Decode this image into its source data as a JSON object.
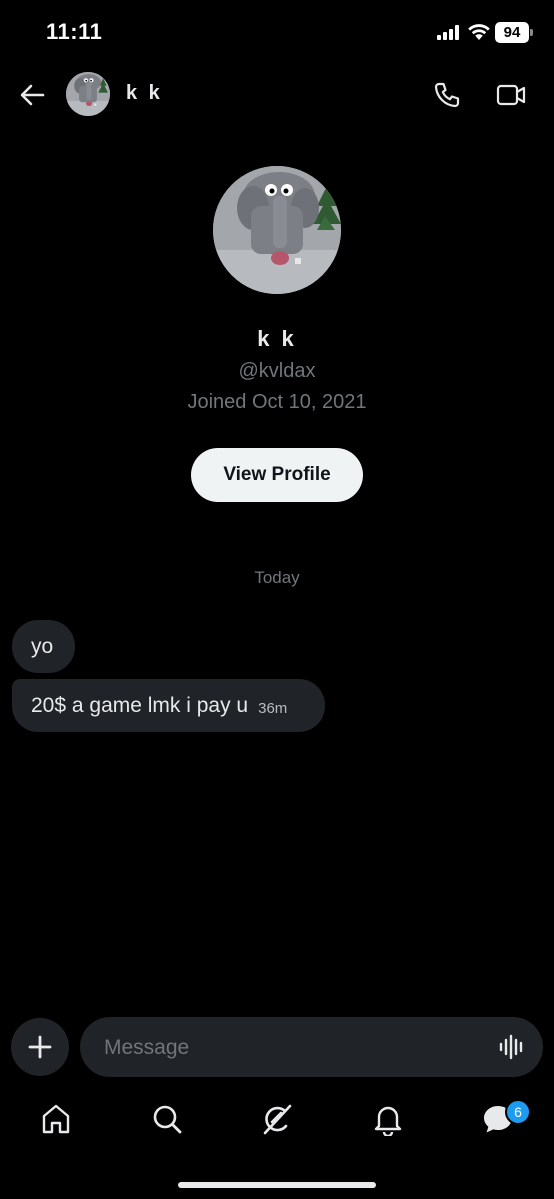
{
  "status_bar": {
    "time": "11:11",
    "battery": "94"
  },
  "header": {
    "name": "k k",
    "avatar_icon": "elephant-avatar"
  },
  "profile": {
    "name": "k k",
    "handle": "@kvldax",
    "joined": "Joined Oct 10, 2021",
    "view_profile_label": "View Profile"
  },
  "chat": {
    "date_separator": "Today",
    "messages": [
      {
        "text": "yo",
        "time": ""
      },
      {
        "text": "20$ a game lmk i pay u",
        "time": "36m"
      }
    ]
  },
  "composer": {
    "placeholder": "Message"
  },
  "nav": {
    "items": [
      "home-icon",
      "search-icon",
      "grok-icon",
      "notifications-icon",
      "messages-icon"
    ],
    "messages_badge": "6"
  },
  "colors": {
    "background": "#000000",
    "bubble": "#202327",
    "secondary_text": "#71767b",
    "accent": "#1d9bf0"
  }
}
